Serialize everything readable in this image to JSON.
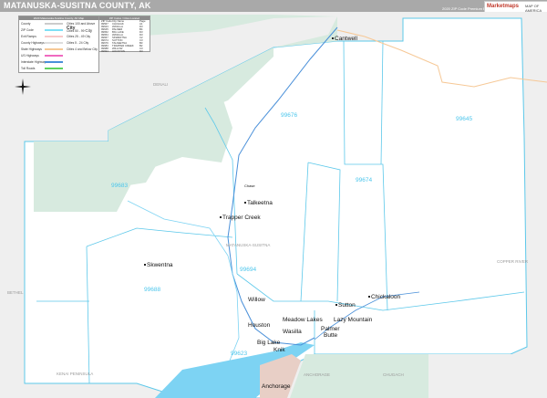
{
  "header": {
    "title": "MATANUSKA-SUSITNA COUNTY, AK",
    "edition": "2020 ZIP Code Premium Edition",
    "logo_text": "Marketmaps",
    "logo_sub": "MAP OF AMERICA"
  },
  "legend": {
    "title": "2020 Matanuska-Susitna County, AK Map",
    "lines": [
      {
        "label": "County",
        "color": "#cccccc"
      },
      {
        "label": "ZIP Code",
        "color": "#7fe0f5"
      },
      {
        "label": "Exit Ramps",
        "color": "#f7c9c9"
      },
      {
        "label": "County Highways",
        "color": "#dddddd"
      },
      {
        "label": "State Highways",
        "color": "#f6c896"
      },
      {
        "label": "US Highways",
        "color": "#f06ac0"
      },
      {
        "label": "Interstate Highways",
        "color": "#4a90d9"
      },
      {
        "label": "Toll Roads",
        "color": "#5ed35e"
      }
    ],
    "cities": [
      {
        "label": "Cities 100 and Above",
        "sample": "City"
      },
      {
        "label": "Cities 50 - 99",
        "sample": "City"
      },
      {
        "label": "Cities 25 - 49",
        "sample": "City"
      },
      {
        "label": "Cities 5 - 24",
        "sample": "City"
      },
      {
        "label": "Cities 4 and Below",
        "sample": "City"
      }
    ]
  },
  "zip_table": {
    "title": "ZIP Codes / Cities Located",
    "headers": [
      "ZIP Code",
      "City Name",
      "Page"
    ],
    "rows": [
      [
        "99567",
        "CHUGIAK",
        "A1"
      ],
      [
        "99623",
        "WASILLA",
        "D3"
      ],
      [
        "99645",
        "PALMER",
        "B4"
      ],
      [
        "99652",
        "BIG LAKE",
        "D3"
      ],
      [
        "99654",
        "WASILLA",
        "D3"
      ],
      [
        "99667",
        "SKWENTNA",
        "C2"
      ],
      [
        "99674",
        "SUTTON",
        "C3"
      ],
      [
        "99676",
        "TALKEETNA",
        "B3"
      ],
      [
        "99683",
        "TRAPPER CREEK",
        "B2"
      ],
      [
        "99688",
        "WILLOW",
        "C3"
      ],
      [
        "99694",
        "HOUSTON",
        "D3"
      ]
    ]
  },
  "towns": [
    {
      "name": "Cantwell"
    },
    {
      "name": "Talkeetna"
    },
    {
      "name": "Trapper Creek"
    },
    {
      "name": "Skwentna"
    },
    {
      "name": "Willow"
    },
    {
      "name": "Houston"
    },
    {
      "name": "Meadow Lakes"
    },
    {
      "name": "Wasilla"
    },
    {
      "name": "Big Lake"
    },
    {
      "name": "Knik"
    },
    {
      "name": "Palmer"
    },
    {
      "name": "Butte"
    },
    {
      "name": "Lazy Mountain"
    },
    {
      "name": "Sutton"
    },
    {
      "name": "Chickaloon"
    },
    {
      "name": "Anchorage"
    },
    {
      "name": "Chase"
    }
  ],
  "zips": [
    "99676",
    "99645",
    "99683",
    "99674",
    "99694",
    "99688",
    "99623"
  ],
  "regions": [
    "BETHEL",
    "KENAI PENINSULA",
    "ANCHORAGE",
    "CHUGACH",
    "COPPER RIVER",
    "MATANUSKA-SUSITNA",
    "DENALI"
  ],
  "colors": {
    "zip_line": "#5cc8ea",
    "park": "#d7eadf",
    "outside": "#efefef",
    "water": "#7dd3f3"
  }
}
